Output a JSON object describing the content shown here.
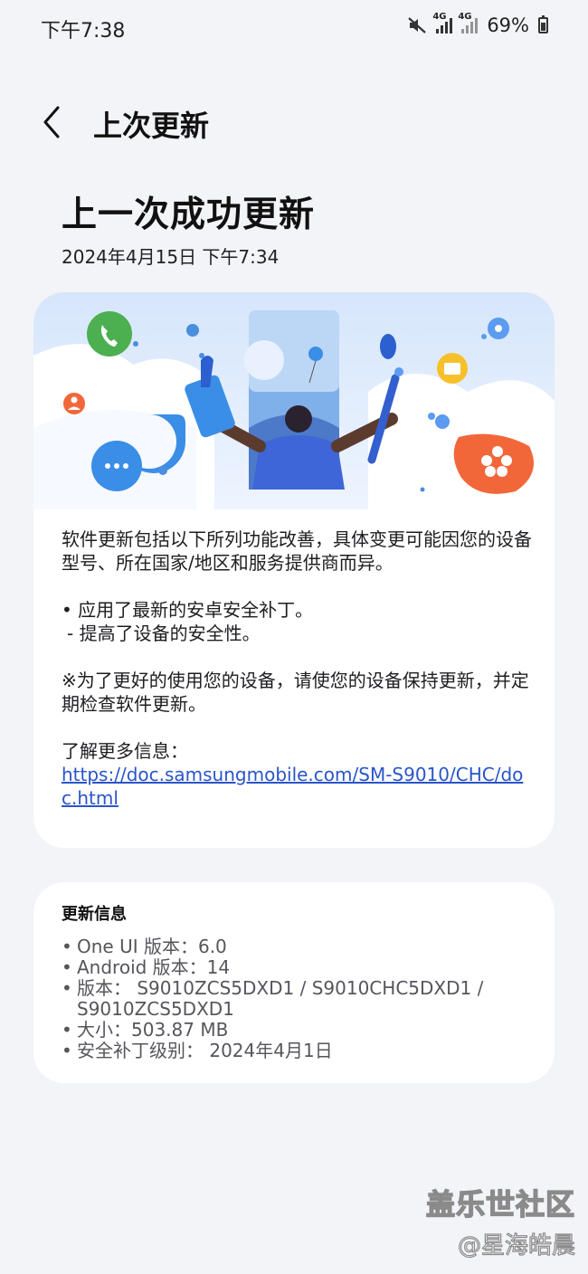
{
  "status_bar": {
    "time": "下午7:38",
    "network1": "4G",
    "network2": "4G",
    "battery": "69%"
  },
  "header": {
    "title": "上次更新"
  },
  "page": {
    "title": "上一次成功更新",
    "date": "2024年4月15日 下午7:34"
  },
  "main_card": {
    "intro": "软件更新包括以下所列功能改善，具体变更可能因您的设备型号、所在国家/地区和服务提供商而异。",
    "bullet": "• 应用了最新的安卓安全补丁。",
    "sub_bullet": "- 提高了设备的安全性。",
    "note": "※为了更好的使用您的设备，请使您的设备保持更新，并定期检查软件更新。",
    "more_info_label": "了解更多信息：",
    "link": "https://doc.samsungmobile.com/SM-S9010/CHC/doc.html"
  },
  "info_card": {
    "heading": "更新信息",
    "items": [
      "One UI 版本：6.0",
      "Android 版本：14",
      "版本： S9010ZCS5DXD1 / S9010CHC5DXD1 / S9010ZCS5DXD1",
      "大小：503.87 MB",
      "安全补丁级别： 2024年4月1日"
    ]
  },
  "watermark": {
    "line1": "盖乐世社区",
    "line2": "@星海皓晨"
  },
  "colors": {
    "background": "#f3f4f8",
    "card": "#ffffff",
    "link": "#2a55c9",
    "accent_orange": "#f2673a",
    "accent_blue": "#3a8ee6",
    "accent_green": "#4caf50"
  }
}
